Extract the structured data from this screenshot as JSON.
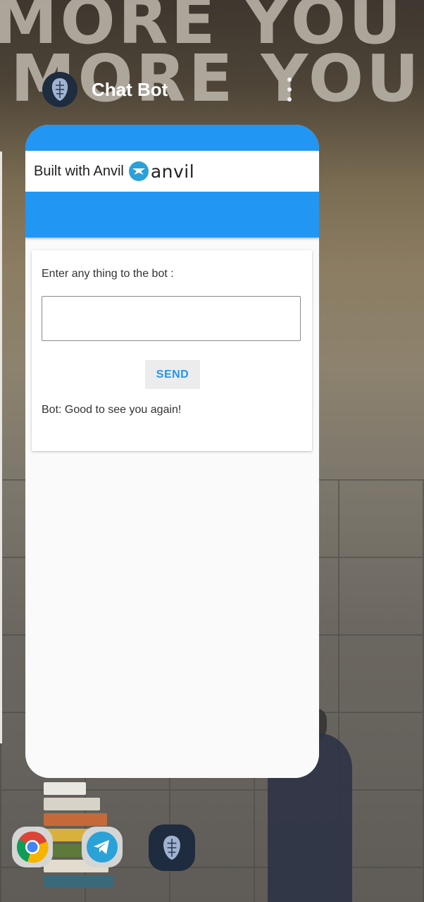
{
  "app": {
    "title": "Chat Bot"
  },
  "wallpaper": {
    "line1": "MORE YOU LEA",
    "line2": "MORE YOU SEI"
  },
  "anvil_banner": {
    "text": "Built with Anvil",
    "logo_word": "anvil"
  },
  "form": {
    "prompt_label": "Enter any thing to the bot :",
    "input_value": "",
    "input_placeholder": "",
    "send_label": "SEND",
    "bot_reply": "Bot: Good to see you again!"
  },
  "dock": {
    "apps": [
      "chrome-icon",
      "telegram-icon",
      "chat-bot-icon"
    ]
  },
  "colors": {
    "accent": "#2196f3",
    "card_bg": "#fafafa",
    "button_bg": "#ececec"
  }
}
